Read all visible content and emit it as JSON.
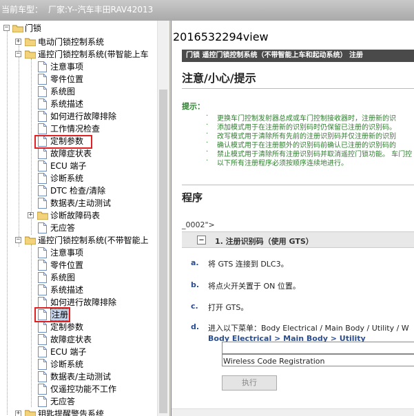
{
  "titlebar": {
    "label": "当前车型：",
    "vehicle": "厂家:Y--汽车丰田RAV42013"
  },
  "tree": {
    "root": "门锁",
    "folder1": "电动门锁控制系统",
    "folder2": "遥控门锁控制系统(带智能上车",
    "folder2_items": [
      "注意事项",
      "零件位置",
      "系统图",
      "系统描述",
      "如何进行故障排除",
      "工作情况检查",
      "定制参数",
      "故障症状表",
      "ECU 端子",
      "诊断系统",
      "DTC 检查/清除",
      "数据表/主动测试"
    ],
    "folder2_sub": "诊断故障码表",
    "folder2_last": "无应答",
    "folder3": "遥控门锁控制系统(不带智能上",
    "folder3_items": [
      "注意事项",
      "零件位置",
      "系统图",
      "系统描述",
      "如何进行故障排除",
      "注册",
      "定制参数",
      "故障症状表",
      "ECU 端子",
      "诊断系统",
      "数据表/主动测试",
      "仅遥控功能不工作",
      "无应答"
    ],
    "folder4": "钥匙提醒警告系统"
  },
  "content": {
    "doc_id": "2016532294view",
    "breadcrumb": "门锁   遥控门锁控制系统（不带智能上车和起动系统）  注册",
    "heading": "注意/小心/提示",
    "hint_label": "提示：",
    "hints": [
      "更换车门控制发射器总成或车门控制接收器时，注册新的识",
      "添加模式用于在注册新的识别码时仍保留已注册的识别码。",
      "改写模式用于清除所有先前的注册识别码并仅注册新的识别",
      "确认模式用于在注册额外的识别码前确认已注册的识别码的",
      "禁止模式用于清除所有注册识别码并取消遥控门锁功能。 车门控",
      "以下所有注册程序必须按顺序连续地进行。"
    ],
    "procedure": "程序",
    "step_code": "_0002\">",
    "step_title": "1. 注册识别码（使用 GTS）",
    "steps": [
      {
        "letter": "a.",
        "text": "将 GTS 连接到 DLC3。"
      },
      {
        "letter": "b.",
        "text": "将点火开关置于 ON 位置。"
      },
      {
        "letter": "c.",
        "text": "打开 GTS。"
      },
      {
        "letter": "d.",
        "text": "进入以下菜单：Body Electrical / Main Body / Utility / W"
      }
    ],
    "menu_path": "Body Electrical > Main Body > Utility",
    "field_value": "Wireless Code Registration",
    "exec_button": "执行"
  },
  "colors": {
    "hint_green": "#2f7d2f",
    "step_blue": "#2a4d8f",
    "highlight_red": "#e02020",
    "breadcrumb_bg": "#4a4a4a"
  }
}
